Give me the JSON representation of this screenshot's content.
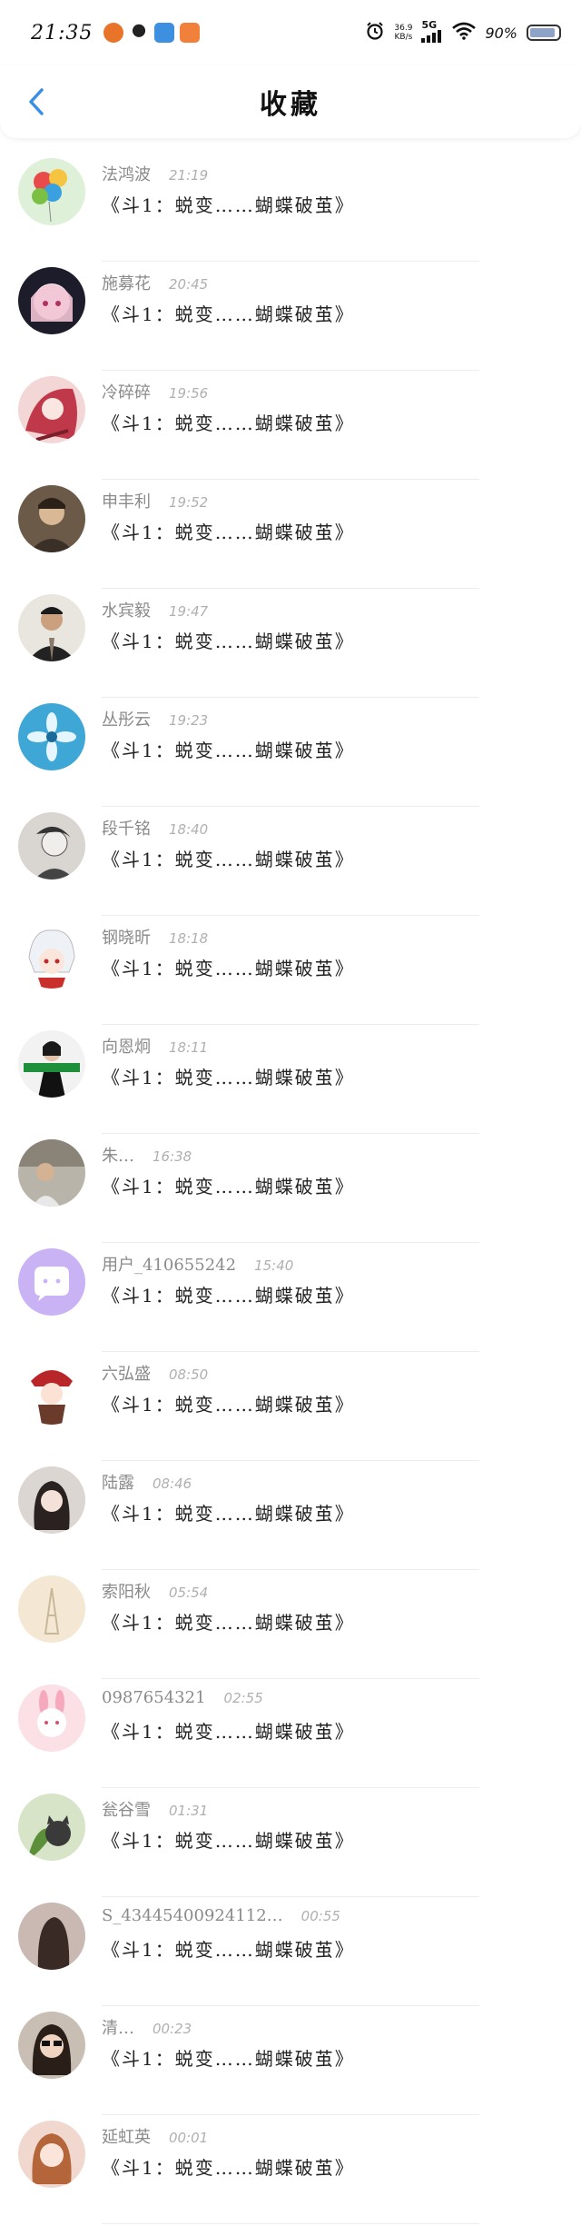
{
  "status_bar": {
    "time": "21:35",
    "net_speed_value": "36.9",
    "net_speed_unit": "KB/s",
    "network": "5G",
    "battery": "90%"
  },
  "header": {
    "title": "收藏"
  },
  "favorites": [
    {
      "name": "法鸿波",
      "time": "21:19",
      "message": "《斗1：蜕变……蝴蝶破茧》",
      "avatar": "balloons"
    },
    {
      "name": "施募花",
      "time": "20:45",
      "message": "《斗1：蜕变……蝴蝶破茧》",
      "avatar": "anime-girl-pink"
    },
    {
      "name": "冷碎碎",
      "time": "19:56",
      "message": "《斗1：蜕变……蝴蝶破茧》",
      "avatar": "anime-girl-red"
    },
    {
      "name": "申丰利",
      "time": "19:52",
      "message": "《斗1：蜕变……蝴蝶破茧》",
      "avatar": "man-photo"
    },
    {
      "name": "水宾毅",
      "time": "19:47",
      "message": "《斗1：蜕变……蝴蝶破茧》",
      "avatar": "man-jacket"
    },
    {
      "name": "丛彤云",
      "time": "19:23",
      "message": "《斗1：蜕变……蝴蝶破茧》",
      "avatar": "blue-flower"
    },
    {
      "name": "段千铭",
      "time": "18:40",
      "message": "《斗1：蜕变……蝴蝶破茧》",
      "avatar": "sketch-person"
    },
    {
      "name": "钢晓昕",
      "time": "18:18",
      "message": "《斗1：蜕变……蝴蝶破茧》",
      "avatar": "cartoon-white-hair"
    },
    {
      "name": "向恩炯",
      "time": "18:11",
      "message": "《斗1：蜕变……蝴蝶破茧》",
      "avatar": "green-text-woman"
    },
    {
      "name": "朱…",
      "time": "16:38",
      "message": "《斗1：蜕变……蝴蝶破茧》",
      "avatar": "man-outdoor"
    },
    {
      "name": "用户_410655242",
      "time": "15:40",
      "message": "《斗1：蜕变……蝴蝶破茧》",
      "avatar": "purple-default"
    },
    {
      "name": "六弘盛",
      "time": "08:50",
      "message": "《斗1：蜕变……蝴蝶破茧》",
      "avatar": "cartoon-red-hat"
    },
    {
      "name": "陆露",
      "time": "08:46",
      "message": "《斗1：蜕变……蝴蝶破茧》",
      "avatar": "woman-portrait"
    },
    {
      "name": "索阳秋",
      "time": "05:54",
      "message": "《斗1：蜕变……蝴蝶破茧》",
      "avatar": "eiffel-tower"
    },
    {
      "name": "0987654321",
      "time": "02:55",
      "message": "《斗1：蜕变……蝴蝶破茧》",
      "avatar": "pink-bunny"
    },
    {
      "name": "瓮谷雪",
      "time": "01:31",
      "message": "《斗1：蜕变……蝴蝶破茧》",
      "avatar": "cat-plant"
    },
    {
      "name": "S_43445400924112…",
      "time": "00:55",
      "message": "《斗1：蜕变……蝴蝶破茧》",
      "avatar": "dark-silhouette"
    },
    {
      "name": "清…",
      "time": "00:23",
      "message": "《斗1：蜕变……蝴蝶破茧》",
      "avatar": "sunglasses-woman"
    },
    {
      "name": "延虹英",
      "time": "00:01",
      "message": "《斗1：蜕变……蝴蝶破茧》",
      "avatar": "girl-portrait"
    }
  ],
  "colors": {
    "accent": "#3a8ee6",
    "name_text": "#8a8a8a",
    "time_text": "#b0b0b0"
  }
}
